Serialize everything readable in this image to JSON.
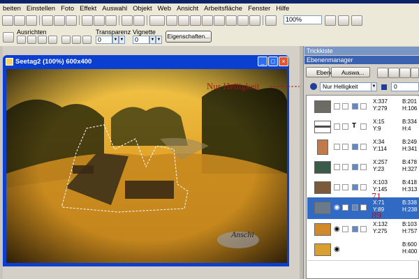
{
  "menu": [
    "beiten",
    "Einstellen",
    "Foto",
    "Effekt",
    "Auswahl",
    "Objekt",
    "Web",
    "Ansicht",
    "Arbeitsfläche",
    "Fenster",
    "Hilfe"
  ],
  "toolbar": {
    "zoom_value": "100%"
  },
  "options": {
    "align_label": "Ausrichten",
    "transparency_label": "Transparenz",
    "transparency_value": "0",
    "vignette_label": "Vignette",
    "vignette_value": "0",
    "properties_button": "Eigenschaften..."
  },
  "image_window": {
    "title": "Seetag2 (100%) 600x400"
  },
  "watermark": "Anschi",
  "panel": {
    "trickkiste": "Trickkiste",
    "ebenenmanager": "Ebenenmanager",
    "btn_ebenen": "Ebene...",
    "btn_auswahl": "Auswa...",
    "blend_mode": "Nur Helligkeit",
    "opacity": "0",
    "annotation": "Nur Helligkeit",
    "annotation_numbers": [
      "71",
      "89"
    ]
  },
  "layers": [
    {
      "x": "X:337",
      "y": "Y:279",
      "b": "B:201",
      "h": "H:106",
      "thumb": "#6c6c64"
    },
    {
      "x": "X:15",
      "y": "Y:9",
      "b": "B:334",
      "h": "H:4",
      "thumb": "#4a4a4a"
    },
    {
      "x": "X:34",
      "y": "Y:114",
      "b": "B:249",
      "h": "H:341",
      "thumb": "#c07a4c"
    },
    {
      "x": "X:257",
      "y": "Y:23",
      "b": "B:478",
      "h": "H:327",
      "thumb": "#3a5a4a"
    },
    {
      "x": "X:103",
      "y": "Y:145",
      "b": "B:418",
      "h": "H:313",
      "thumb": "#7a5a3a"
    },
    {
      "x": "X:71",
      "y": "Y:89",
      "b": "B:338",
      "h": "H:238",
      "thumb": "#6a7a8a"
    },
    {
      "x": "X:132",
      "y": "Y:275",
      "b": "B:103",
      "h": "H:757",
      "thumb": "#d08a2a"
    },
    {
      "x": "",
      "y": "",
      "b": "B:600",
      "h": "H:400",
      "thumb": "#d8a030"
    }
  ],
  "colors": {
    "accent": "#0a3fd1",
    "selection": "#316ac5",
    "annotation": "#a3171b"
  }
}
